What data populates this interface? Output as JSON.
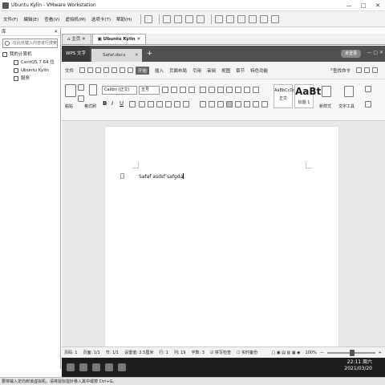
{
  "window": {
    "title": "Ubuntu Kylin - VMware Workstation",
    "controls": [
      "—",
      "□",
      "✕"
    ]
  },
  "vm_menu": [
    "文件(F)",
    "编辑(E)",
    "查看(V)",
    "虚拟机(M)",
    "选项卡(T)",
    "帮助(H)"
  ],
  "library": {
    "title": "库",
    "close": "✕",
    "search_placeholder": "在此处键入内容进行搜索",
    "tree": [
      {
        "label": "我的计算机",
        "level": 0
      },
      {
        "label": "CentOS 7 64 位",
        "level": 1
      },
      {
        "label": "Ubuntu Kylin",
        "level": 1
      },
      {
        "label": "服务",
        "level": 1
      }
    ]
  },
  "vm_tabs": [
    {
      "label": "主页",
      "active": false
    },
    {
      "label": "Ubuntu Kylin",
      "active": true
    }
  ],
  "wps": {
    "app_tab": "WPS 文字",
    "doc_tab": "Safaf.docx",
    "login": "未登录",
    "menu": [
      "文件",
      "开始",
      "插入",
      "页面布局",
      "引用",
      "审阅",
      "视图",
      "章节",
      "特色功能"
    ],
    "active_menu": "开始",
    "search_cmd": "查找命令",
    "ribbon": {
      "paste": "粘贴",
      "format_painter": "格式刷",
      "font_name": "Calibri (正文)",
      "font_size": "五号",
      "style_normal_sample": "AaBbCcDd",
      "style_normal": "正文",
      "style_h1_sample": "AaBt",
      "style_h1": "标题 1",
      "new_style": "新样式",
      "text_tools": "文字工具",
      "bold": "B",
      "italic": "I",
      "underline": "U"
    },
    "document_text": "Safaf asdsf safgda",
    "status": {
      "page_no": "页码: 1",
      "pages": "页面: 1/1",
      "section": "节: 1/1",
      "setting": "设置值: 2.5厘米",
      "row": "行: 1",
      "col": "列: 19",
      "words": "字数: 3",
      "spell": "拼写检查",
      "backup": "实时备份",
      "zoom": "100%",
      "zoom_minus": "—",
      "zoom_plus": "+"
    }
  },
  "taskbar": {
    "time": "22:11 周六",
    "date": "2021/03/20"
  },
  "vm_hint": "要将输入定向到该虚拟机，请将鼠标指针移入其中或按 Ctrl+G。"
}
